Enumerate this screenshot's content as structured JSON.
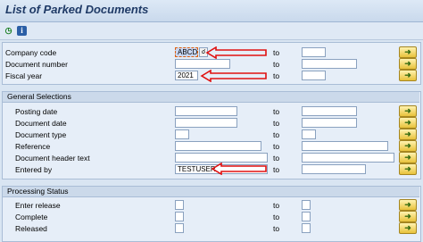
{
  "title": "List of Parked Documents",
  "toolbar": {
    "execute_icon": "execute-icon",
    "info_icon": "info-icon"
  },
  "main": {
    "company_code": {
      "label": "Company code",
      "value": "ABCD",
      "to": "to"
    },
    "document_number": {
      "label": "Document number",
      "to": "to"
    },
    "fiscal_year": {
      "label": "Fiscal year",
      "value": "2021",
      "to": "to"
    }
  },
  "general": {
    "heading": "General Selections",
    "posting_date": {
      "label": "Posting date",
      "to": "to"
    },
    "document_date": {
      "label": "Document date",
      "to": "to"
    },
    "document_type": {
      "label": "Document type",
      "to": "to"
    },
    "reference": {
      "label": "Reference",
      "to": "to"
    },
    "header_text": {
      "label": "Document header text",
      "to": "to"
    },
    "entered_by": {
      "label": "Entered by",
      "value": "TESTUSER",
      "to": "to"
    }
  },
  "processing": {
    "heading": "Processing Status",
    "enter_release": {
      "label": "Enter release",
      "to": "to"
    },
    "complete": {
      "label": "Complete",
      "to": "to"
    },
    "released": {
      "label": "Released",
      "to": "to"
    }
  },
  "colors": {
    "annotation_arrow": "#e01010",
    "multi_button": "#e8c23a"
  }
}
